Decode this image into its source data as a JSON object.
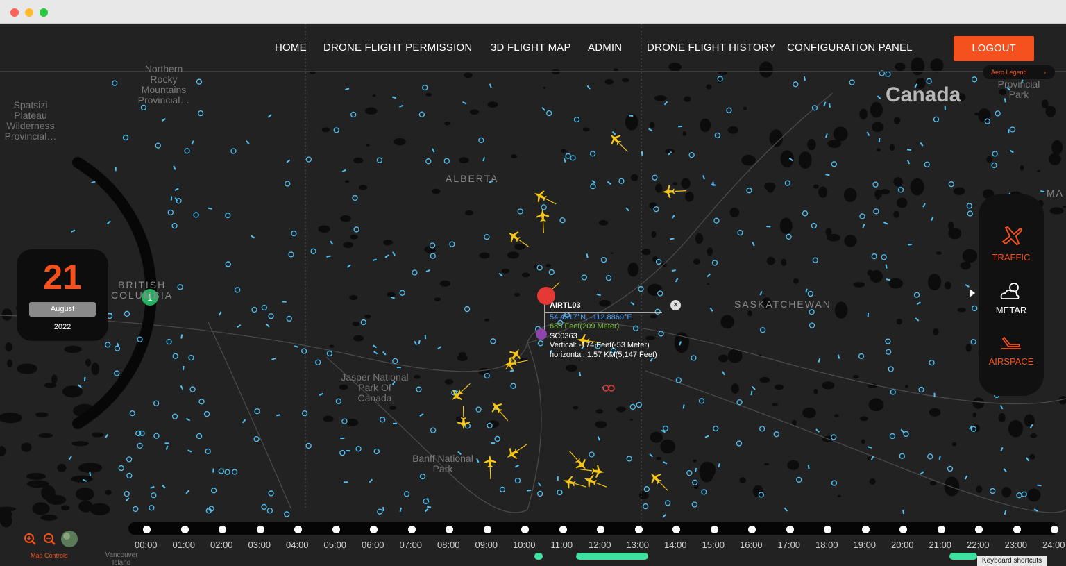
{
  "nav": {
    "items": [
      "HOME",
      "DRONE FLIGHT PERMISSION",
      "3D FLIGHT MAP",
      "ADMIN",
      "DRONE FLIGHT HISTORY",
      "CONFIGURATION PANEL"
    ],
    "logout": "LOGOUT",
    "aero_legend": "Aero Legend"
  },
  "map": {
    "country": "Canada",
    "regions": [
      "ALBERTA",
      "BRITISH",
      "COLUMBIA",
      "SASKATCHEWAN",
      "MA"
    ],
    "places": [
      "Northern Rocky Mountains Provincial…",
      "Spatsizi Plateau Wilderness Provincial…",
      "Jasper National Park Of Canada",
      "Banff National Park",
      "Vancouver Island",
      "Provincial Park"
    ],
    "cluster_count": "1"
  },
  "date": {
    "day": "21",
    "month": "August",
    "year": "2022"
  },
  "right_panel": {
    "traffic": "TRAFFIC",
    "metar": "METAR",
    "airspace": "AIRSPACE"
  },
  "popup": {
    "callsign": "AIRTL03",
    "coords": "54.4517°N, -112.8869°E",
    "altitude": "685 Feet(209 Meter)",
    "drone_id": "SC0363",
    "vertical": "Vertical: -174 Feet(-53 Meter)",
    "horizontal": "horizontal: 1.57 KM(5,147 Feet)"
  },
  "timeline": {
    "labels": [
      "00:00",
      "01:00",
      "02:00",
      "03:00",
      "04:00",
      "05:00",
      "06:00",
      "07:00",
      "08:00",
      "09:00",
      "10:00",
      "11:00",
      "12:00",
      "13:00",
      "14:00",
      "15:00",
      "16:00",
      "17:00",
      "18:00",
      "19:00",
      "20:00",
      "21:00",
      "22:00",
      "23:00",
      "24:00"
    ]
  },
  "controls": {
    "label": "Map Controls",
    "keyboard": "Keyboard shortcuts"
  },
  "colors": {
    "accent": "#f4511e",
    "aircraft": "#f5c518",
    "marker": "#4fc3f7",
    "timeline_active": "#3ee0a0"
  }
}
